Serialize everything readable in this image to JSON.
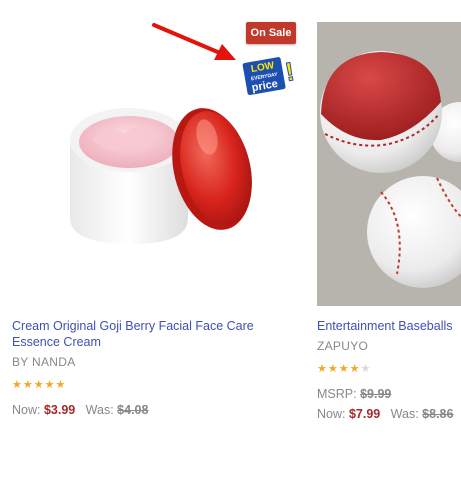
{
  "products": [
    {
      "badge": "On Sale",
      "badge_color": "#c0392b",
      "promo_icon": "low-everyday-price-icon",
      "promo_text": [
        "LOW",
        "EVERYDAY",
        "price",
        "!"
      ],
      "title_line1": "Cream Original Goji Berry Facial Face Care",
      "title_line2": "Essence Cream",
      "brand": "BY NANDA",
      "rating": 5,
      "now_label": "Now:",
      "now_price": "$3.99",
      "was_label": "Was:",
      "was_price": "$4.08"
    },
    {
      "title": "Entertainment Baseballs",
      "brand": "ZAPUYO",
      "rating": 4,
      "msrp_label": "MSRP:",
      "msrp_price": "$9.99",
      "now_label": "Now:",
      "now_price": "$7.99",
      "was_label": "Was:",
      "was_price": "$8.86"
    }
  ],
  "colors": {
    "link": "#3f51b5",
    "price_now": "#a52a2a",
    "star": "#f5a623"
  }
}
